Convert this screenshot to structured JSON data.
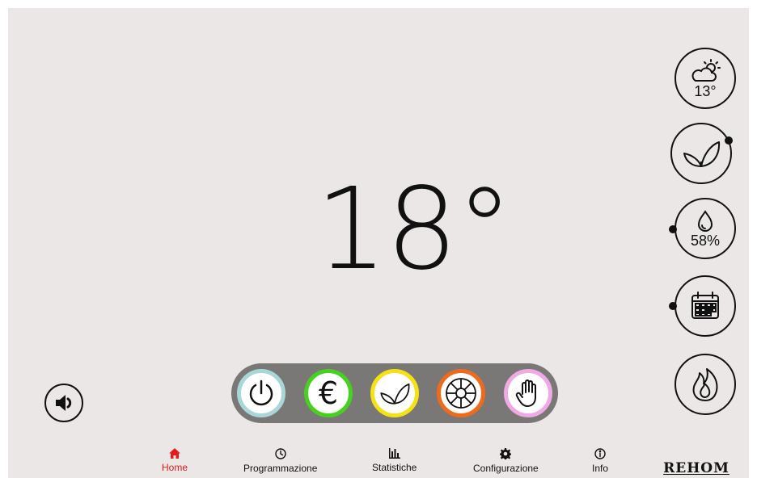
{
  "main": {
    "temperature": "18°"
  },
  "side": {
    "weather": {
      "icon": "cloud-sun-icon",
      "value": "13°"
    },
    "eco": {
      "icon": "leaf-icon"
    },
    "humidity": {
      "icon": "drop-icon",
      "value": "58%"
    },
    "calendar": {
      "icon": "calendar-icon"
    },
    "flame": {
      "icon": "flame-icon"
    }
  },
  "modes": [
    {
      "icon": "power-icon",
      "ring": "#a9d7d8"
    },
    {
      "icon": "euro-icon",
      "ring": "#46d11e"
    },
    {
      "icon": "leaf-icon",
      "ring": "#f2e216"
    },
    {
      "icon": "fan-icon",
      "ring": "#f06a1c"
    },
    {
      "icon": "hand-icon",
      "ring": "#f1a9e6"
    }
  ],
  "nav": {
    "home": "Home",
    "programmazione": "Programmazione",
    "statistiche": "Statistiche",
    "configurazione": "Configurazione",
    "info": "Info",
    "active_color": "#e31b1b"
  },
  "brand": {
    "logo": "REHOM"
  }
}
